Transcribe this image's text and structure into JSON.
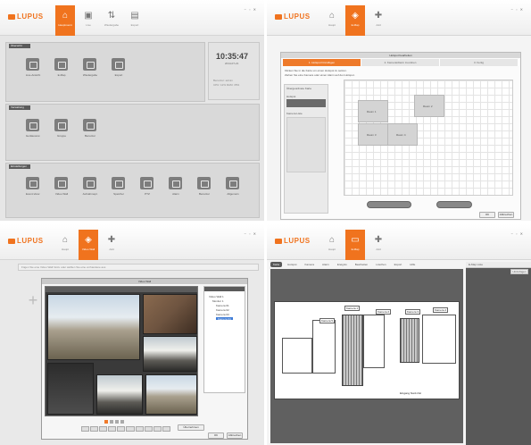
{
  "brand": {
    "logo_text": "LUPUS",
    "accent": "#f0731e"
  },
  "window_controls": "− ▫ ✕",
  "q1": {
    "nav": [
      {
        "label": "Hauptmenü",
        "icon": "home-icon",
        "active": true
      },
      {
        "label": "Live",
        "icon": "live-icon",
        "active": false
      },
      {
        "label": "Wiedergabe",
        "icon": "playback-icon",
        "active": false
      },
      {
        "label": "Export",
        "icon": "export-icon",
        "active": false
      }
    ],
    "sections": [
      {
        "title": "Übersicht",
        "tiles": [
          "Live-Ansicht",
          "E-Map",
          "Wiedergabe",
          "Export"
        ]
      },
      {
        "title": "Verwaltung",
        "tiles": [
          "Geräteverw.",
          "Gruppe",
          "Benutzer"
        ]
      },
      {
        "title": "Einstellungen",
        "tiles": [
          "Event-Verw.",
          "Video Wall",
          "Aufnahmepl.",
          "Speicher",
          "PTZ",
          "Alarm",
          "Benutzer",
          "Allgemein"
        ]
      }
    ],
    "clock": {
      "time": "10:35:47",
      "date": "2014-07-21",
      "info_line1": "Benutzer: admin",
      "info_line2": "CPU: 12%  RAM: 35%"
    }
  },
  "q2": {
    "nav": [
      {
        "label": "Haupt",
        "icon": "home-icon",
        "active": false
      },
      {
        "label": "E-Map",
        "icon": "map-icon",
        "active": true
      },
      {
        "label": "Add",
        "icon": "plus-icon",
        "active": false
      }
    ],
    "dialog_title": "Hotspot bearbeiten",
    "steps": [
      "1. Hotspot hinzufügen",
      "2. Kamera/Alarm zuordnen",
      "3. Fertig"
    ],
    "instructions": [
      "Klicken Sie in die Karte um einen Hotspot zu setzen.",
      "Ziehen Sie eine Kamera oder einen Alarm auf den Hotspot."
    ],
    "side_labels": [
      "Übergeordnete Karte",
      "Hotspot",
      "Kamera Liste"
    ],
    "rooms": [
      "Raum 1",
      "Raum 2",
      "Raum 3",
      "Raum 4"
    ],
    "buttons": {
      "ok": "OK",
      "cancel": "Abbrechen"
    }
  },
  "q3": {
    "nav": [
      {
        "label": "Haupt",
        "icon": "home-icon",
        "active": false
      },
      {
        "label": "Video Wall",
        "icon": "videowall-icon",
        "active": true
      },
      {
        "label": "Add",
        "icon": "plus-icon",
        "active": false
      }
    ],
    "hint": "Fügen Sie eine Video Wall hinzu oder wählen Sie eine vorhandene aus",
    "window_title": "Video Wall",
    "tree": {
      "items": [
        "Video Wall 1",
        "Monitor 1",
        "Kamera 01",
        "Kamera 02",
        "Kamera 03",
        "Kamera 04"
      ],
      "selected_index": 5
    },
    "buttons": {
      "apply": "Übernehmen",
      "ok": "OK",
      "cancel": "Abbrechen"
    }
  },
  "q4": {
    "nav": [
      {
        "label": "Haupt",
        "icon": "home-icon",
        "active": false
      },
      {
        "label": "E-Map",
        "icon": "map-icon",
        "active": true
      },
      {
        "label": "Add",
        "icon": "plus-icon",
        "active": false
      }
    ],
    "tabs": [
      "Karte",
      "Hotspot",
      "Kamera",
      "Alarm",
      "Ereignis",
      "Bearbeiten",
      "Löschen",
      "Export",
      "Hilfe"
    ],
    "right_panel_title": "E-Map Liste",
    "right_panel_button": "Hinzufügen",
    "floor_labels": [
      "Kamera 1",
      "Kamera 2",
      "Kamera 3",
      "Kamera 4",
      "Kamera 5"
    ],
    "floor_caption": "Eingang Nord-Ost"
  }
}
